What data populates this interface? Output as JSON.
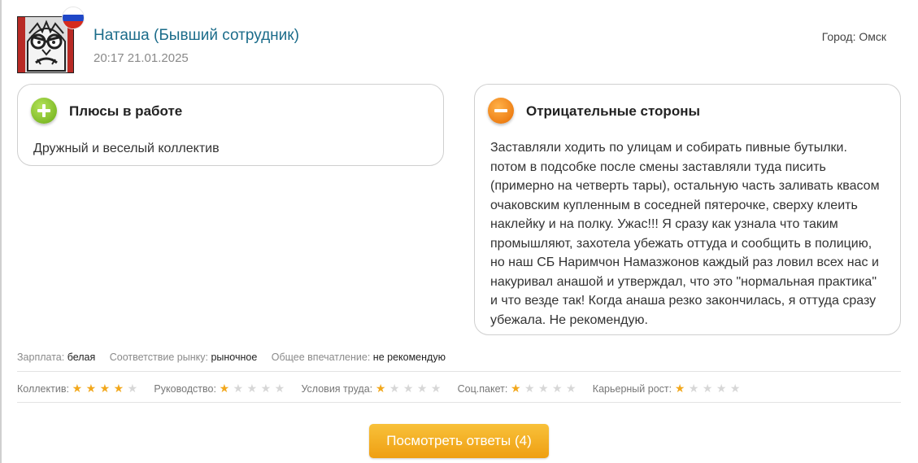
{
  "review": {
    "author": "Наташа (Бывший сотрудник)",
    "date": "20:17 21.01.2025",
    "city": "Город: Омск",
    "flag_colors": [
      "#ffffff",
      "#1f47c7",
      "#d52b1e"
    ],
    "avatar_icon": "angry-face-avatar"
  },
  "pros": {
    "title": "Плюсы в работе",
    "icon": "plus-icon",
    "text": "Дружный и веселый коллектив"
  },
  "cons": {
    "title": "Отрицательные стороны",
    "icon": "minus-icon",
    "text": "Заставляли ходить по улицам и собирать пивные бутылки. потом в подсобке после смены заставляли туда писить (примерно на четверть тары), остальную часть заливать квасом очаковским купленным в соседней пятерочке, сверху клеить наклейку и на полку. Ужас!!! Я сразу как узнала что таким промышляют, захотела убежать оттуда и сообщить в полицию, но наш СБ Наримчон Намазжонов каждый раз ловил всех нас и накуривал анашой и утверждал, что это \"нормальная практика\" и что везде так! Когда анаша резко закончилась, я оттуда сразу убежала. Не рекомендую."
  },
  "meta": [
    {
      "label": "Зарплата:",
      "value": "белая"
    },
    {
      "label": "Соответствие рынку:",
      "value": "рыночное"
    },
    {
      "label": "Общее впечатление:",
      "value": "не рекомендую"
    }
  ],
  "ratings": [
    {
      "label": "Коллектив:",
      "stars": 4,
      "max": 5
    },
    {
      "label": "Руководство:",
      "stars": 1,
      "max": 5
    },
    {
      "label": "Условия труда:",
      "stars": 1,
      "max": 5
    },
    {
      "label": "Соц.пакет:",
      "stars": 1,
      "max": 5
    },
    {
      "label": "Карьерный рост:",
      "stars": 1,
      "max": 5
    }
  ],
  "colors": {
    "author_link": "#1b6c8a",
    "star_on": "#f2a81d",
    "star_off": "#d7d7d7",
    "button": "#f3b12a"
  },
  "button": {
    "label": "Посмотреть ответы (4)"
  }
}
